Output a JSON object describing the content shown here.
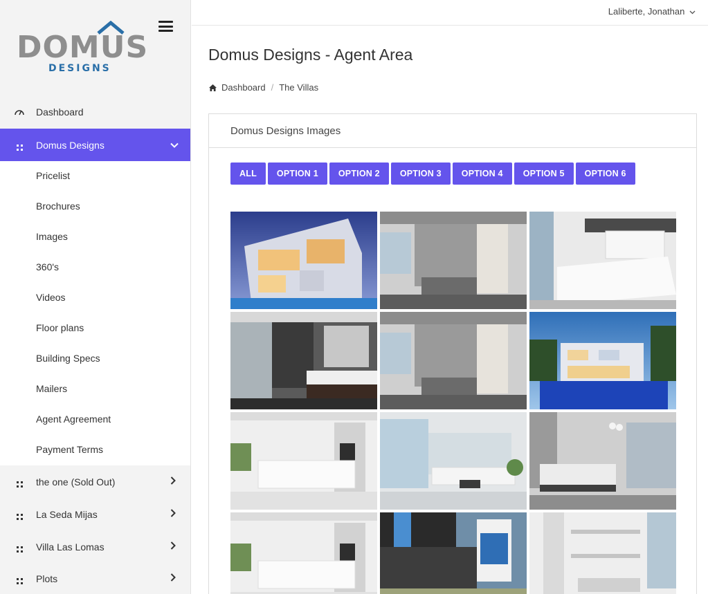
{
  "brand": {
    "word": "DOMUS",
    "sub": "DESIGNS"
  },
  "header": {
    "user": "Laliberte, Jonathan"
  },
  "page": {
    "title": "Domus Designs - Agent Area"
  },
  "breadcrumb": {
    "home": "Dashboard",
    "current": "The Villas"
  },
  "sidebar": {
    "dashboard": "Dashboard",
    "active_section": "Domus Designs",
    "subitems": [
      "Pricelist",
      "Brochures",
      "Images",
      "360's",
      "Videos",
      "Floor plans",
      "Building Specs",
      "Mailers",
      "Agent Agreement",
      "Payment Terms"
    ],
    "sections": [
      "the one (Sold Out)",
      "La Seda Mijas",
      "Villa Las Lomas",
      "Plots"
    ]
  },
  "panel": {
    "title": "Domus Designs Images",
    "filters": [
      "ALL",
      "OPTION 1",
      "OPTION 2",
      "OPTION 3",
      "OPTION 4",
      "OPTION 5",
      "OPTION 6"
    ]
  },
  "gallery": [
    {
      "name": "villa-exterior-dusk-photo"
    },
    {
      "name": "stone-bathroom-photo"
    },
    {
      "name": "white-bedroom-photo"
    },
    {
      "name": "dark-bathroom-photo"
    },
    {
      "name": "stone-bathroom-photo-2"
    },
    {
      "name": "villa-pool-night-photo"
    },
    {
      "name": "white-kitchen-photo"
    },
    {
      "name": "living-room-photo"
    },
    {
      "name": "grey-bedroom-photo"
    },
    {
      "name": "white-kitchen-photo-2"
    },
    {
      "name": "villa-facade-photo"
    },
    {
      "name": "double-height-interior-photo"
    }
  ],
  "colors": {
    "accent": "#6454ec",
    "logo_grey": "#8e8e8e",
    "logo_blue": "#2a6fa8"
  }
}
